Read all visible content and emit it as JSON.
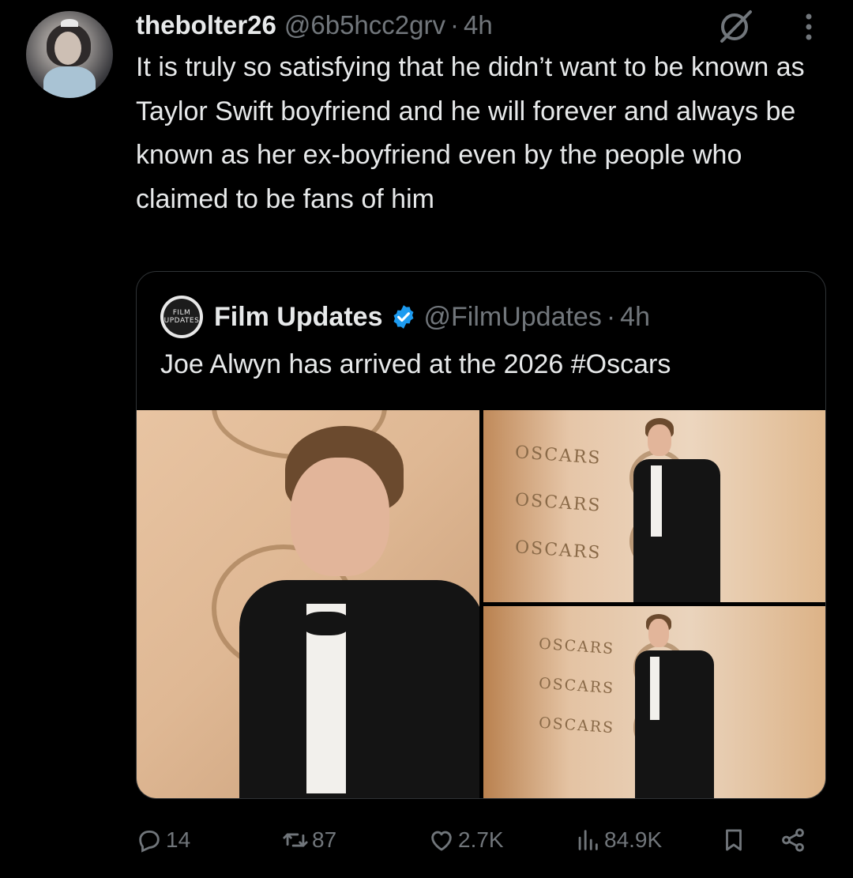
{
  "tweet": {
    "display_name": "thebolter26",
    "handle": "@6b5hcc2grv",
    "separator": "·",
    "time": "4h",
    "text": "It is truly so satisfying that he didn’t want to be known as Taylor Swift boyfriend and he will forever and always be known as her ex-boyfriend even by the people who claimed to be fans of him"
  },
  "quoted": {
    "avatar_text_line1": "FILM",
    "avatar_text_line2": "UPDATES",
    "display_name": "Film Updates",
    "handle": "@FilmUpdates",
    "separator": "·",
    "time": "4h",
    "text": "Joe Alwyn has arrived at the 2026 #Oscars",
    "media_backdrop_text": "OSCARS"
  },
  "actions": {
    "replies": "14",
    "reposts": "87",
    "likes": "2.7K",
    "views": "84.9K"
  },
  "icons": {
    "grok": "grok-icon",
    "more": "more-icon",
    "verified": "verified-badge-icon",
    "reply": "reply-icon",
    "repost": "repost-icon",
    "like": "heart-icon",
    "views": "views-icon",
    "bookmark": "bookmark-icon",
    "share": "share-icon"
  },
  "colors": {
    "background": "#000000",
    "text": "#e7e9ea",
    "secondary": "#71767b",
    "verified": "#1d9bf0",
    "border": "#2f3336"
  }
}
